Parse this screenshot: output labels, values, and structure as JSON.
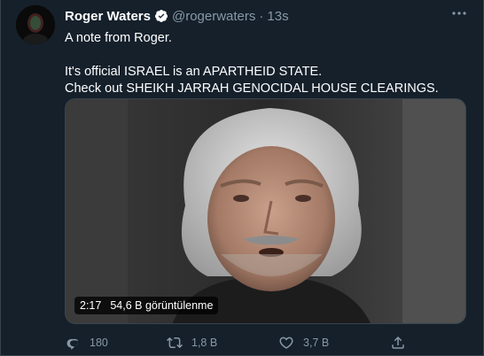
{
  "tweet": {
    "author_name": "Roger Waters",
    "handle": "@rogerwaters",
    "separator": "·",
    "time": "13s",
    "lines": [
      "A note from Roger.",
      "It's official ISRAEL is an APARTHEID STATE.",
      "Check out SHEIKH JARRAH GENOCIDAL HOUSE CLEARINGS."
    ]
  },
  "video": {
    "duration": "2:17",
    "views": "54,6 B görüntülenme"
  },
  "actions": {
    "replies": "180",
    "retweets": "1,8 B",
    "likes": "3,7 B"
  },
  "icons": {
    "verified": "verified-badge-icon",
    "more": "more-options-icon",
    "reply": "reply-icon",
    "retweet": "retweet-icon",
    "like": "heart-icon",
    "share": "share-icon"
  },
  "colors": {
    "background": "#15202b",
    "text": "#ffffff",
    "muted": "#8899a6",
    "accent": "#1da1f2",
    "border": "#38444d"
  }
}
